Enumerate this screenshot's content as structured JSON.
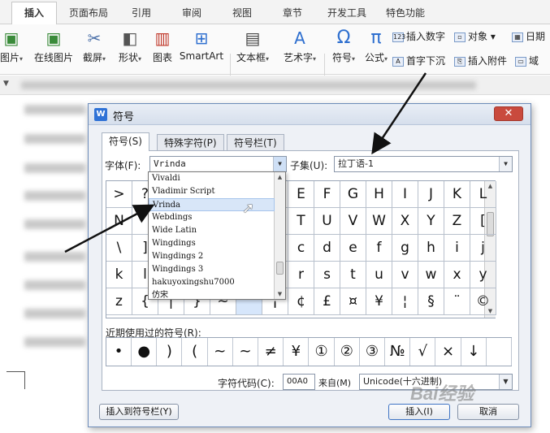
{
  "menu_tabs": [
    "插入",
    "页面布局",
    "引用",
    "审阅",
    "视图",
    "章节",
    "开发工具",
    "特色功能"
  ],
  "ribbon": {
    "big_buttons": [
      {
        "label": "图片",
        "icon": "picture-icon",
        "has_dropdown": true
      },
      {
        "label": "在线图片",
        "icon": "online-picture-icon",
        "has_dropdown": false
      },
      {
        "label": "截屏",
        "icon": "screenshot-icon",
        "has_dropdown": true
      },
      {
        "label": "形状",
        "icon": "shapes-icon",
        "has_dropdown": true
      },
      {
        "label": "图表",
        "icon": "chart-icon",
        "has_dropdown": false
      },
      {
        "label": "SmartArt",
        "icon": "smartart-icon",
        "has_dropdown": false
      },
      {
        "label": "文本框",
        "icon": "textbox-icon",
        "has_dropdown": true
      },
      {
        "label": "艺术字",
        "icon": "wordart-icon",
        "has_dropdown": true
      },
      {
        "label": "符号",
        "icon": "omega-icon",
        "has_dropdown": true
      },
      {
        "label": "公式",
        "icon": "pi-icon",
        "has_dropdown": true
      }
    ],
    "small_buttons": [
      {
        "label": "插入数字",
        "icon": "insert-number-icon",
        "glyph": "123"
      },
      {
        "label": "对象",
        "icon": "object-icon",
        "glyph": "▫"
      },
      {
        "label": "日期",
        "icon": "date-icon",
        "glyph": "▦"
      },
      {
        "label": "首字下沉",
        "icon": "dropcap-icon",
        "glyph": "A"
      },
      {
        "label": "插入附件",
        "icon": "attachment-icon",
        "glyph": "⎘"
      },
      {
        "label": "域",
        "icon": "field-icon",
        "glyph": "▭"
      }
    ]
  },
  "dialog": {
    "title": "符号",
    "close_glyph": "✕",
    "tabs": [
      "符号(S)",
      "特殊字符(P)",
      "符号栏(T)"
    ],
    "font_label": "字体(F):",
    "font_value": "Vrinda",
    "subset_label": "子集(U):",
    "subset_value": "拉丁语-1",
    "font_list": [
      "Vivaldi",
      "Vladimir Script",
      "Vrinda",
      "Webdings",
      "Wide Latin",
      "Wingdings",
      "Wingdings 2",
      "Wingdings 3",
      "hakuyoxingshu7000",
      "仿宋"
    ],
    "font_list_selected_index": 2,
    "symbol_grid": [
      [
        ">",
        "?",
        "",
        "",
        "",
        "",
        "",
        "E",
        "F",
        "G",
        "H",
        "I",
        "J",
        "K",
        "L"
      ],
      [
        "N",
        "",
        "",
        "",
        "",
        "",
        "",
        "T",
        "U",
        "V",
        "W",
        "X",
        "Y",
        "Z",
        "["
      ],
      [
        "\\",
        "]",
        "",
        "",
        "",
        "",
        "",
        "c",
        "d",
        "e",
        "f",
        "g",
        "h",
        "i",
        "j"
      ],
      [
        "k",
        "l",
        "",
        "",
        "",
        "",
        "",
        "r",
        "s",
        "t",
        "u",
        "v",
        "w",
        "x",
        "y"
      ],
      [
        "z",
        "{",
        "|",
        "}",
        "~",
        "",
        "¡",
        "¢",
        "£",
        "¤",
        "¥",
        "¦",
        "§",
        "¨",
        "©"
      ]
    ],
    "recent_label": "近期使用过的符号(R):",
    "recent_symbols": [
      "•",
      "●",
      ")",
      "(",
      "~",
      "~",
      "≠",
      "¥",
      "①",
      "②",
      "③",
      "№",
      "√",
      "×",
      "↓",
      ""
    ],
    "char_code_label": "字符代码(C):",
    "char_code_value": "00A0",
    "from_label": "来自(M)",
    "from_value": "Unicode(十六进制)",
    "insert_to_bar_button": "插入到符号栏(Y)",
    "insert_button": "插入(I)",
    "cancel_button": "取消"
  },
  "watermark": "Bai经验"
}
